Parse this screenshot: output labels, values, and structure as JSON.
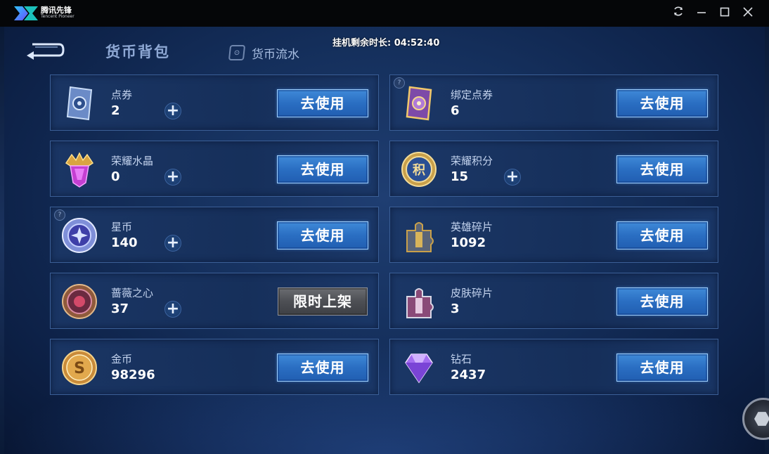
{
  "window": {
    "app_name": "腾讯先锋",
    "app_subtitle": "Tencent Pioneer",
    "icons": [
      "refresh-icon",
      "minimize-icon",
      "maximize-icon",
      "close-icon"
    ]
  },
  "header": {
    "title": "货币背包",
    "flow_tab_label": "货币流水",
    "timer_label": "挂机剩余时长: 04:52:40"
  },
  "currencies": [
    {
      "name": "点券",
      "value": "2",
      "button": "去使用",
      "plus": "+",
      "icon": "coupon-card-icon"
    },
    {
      "name": "绑定点券",
      "value": "6",
      "button": "去使用",
      "help": "?",
      "icon": "bound-coupon-card-icon"
    },
    {
      "name": "荣耀水晶",
      "value": "0",
      "button": "去使用",
      "plus": "+",
      "icon": "glory-crystal-icon"
    },
    {
      "name": "荣耀积分",
      "value": "15",
      "button": "去使用",
      "plus": "+",
      "icon": "glory-points-icon",
      "icon_text": "积"
    },
    {
      "name": "星币",
      "value": "140",
      "button": "去使用",
      "plus": "+",
      "help": "?",
      "icon": "star-coin-icon"
    },
    {
      "name": "英雄碎片",
      "value": "1092",
      "button": "去使用",
      "icon": "hero-fragment-icon"
    },
    {
      "name": "蔷薇之心",
      "value": "37",
      "button": "限时上架",
      "plus": "+",
      "icon": "rose-heart-icon"
    },
    {
      "name": "皮肤碎片",
      "value": "3",
      "button": "去使用",
      "icon": "skin-fragment-icon"
    },
    {
      "name": "金币",
      "value": "98296",
      "button": "去使用",
      "icon": "gold-coin-icon",
      "icon_text": "S"
    },
    {
      "name": "钻石",
      "value": "2437",
      "button": "去使用",
      "icon": "diamond-icon"
    }
  ],
  "colors": {
    "use_button": "#2a6ec2",
    "limited_button": "#4d4f54",
    "card_border": "#3b5f97",
    "background": "#15305d"
  }
}
